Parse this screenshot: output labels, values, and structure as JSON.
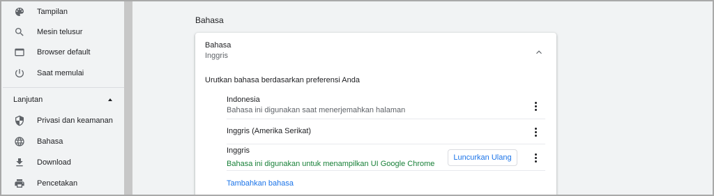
{
  "sidebar": {
    "items": [
      {
        "label": "Tampilan",
        "icon": "palette-icon"
      },
      {
        "label": "Mesin telusur",
        "icon": "search-icon"
      },
      {
        "label": "Browser default",
        "icon": "browser-icon"
      },
      {
        "label": "Saat memulai",
        "icon": "power-icon"
      }
    ],
    "advanced": {
      "label": "Lanjutan",
      "expanded": true
    },
    "advanced_items": [
      {
        "label": "Privasi dan keamanan",
        "icon": "shield-icon"
      },
      {
        "label": "Bahasa",
        "icon": "globe-icon"
      },
      {
        "label": "Download",
        "icon": "download-icon"
      },
      {
        "label": "Pencetakan",
        "icon": "printer-icon"
      }
    ]
  },
  "main": {
    "section_title": "Bahasa",
    "card": {
      "title": "Bahasa",
      "subtitle": "Inggris",
      "order_label": "Urutkan bahasa berdasarkan preferensi Anda",
      "languages": [
        {
          "name": "Indonesia",
          "description": "Bahasa ini digunakan saat menerjemahkan halaman"
        },
        {
          "name": "Inggris (Amerika Serikat)",
          "description": ""
        },
        {
          "name": "Inggris",
          "description": "Bahasa ini digunakan untuk menampilkan UI Google Chrome"
        }
      ],
      "relaunch_label": "Luncurkan Ulang",
      "add_language_label": "Tambahkan bahasa"
    }
  },
  "colors": {
    "accent": "#1a73e8",
    "success_text": "#188038",
    "background": "#f1f3f4"
  }
}
